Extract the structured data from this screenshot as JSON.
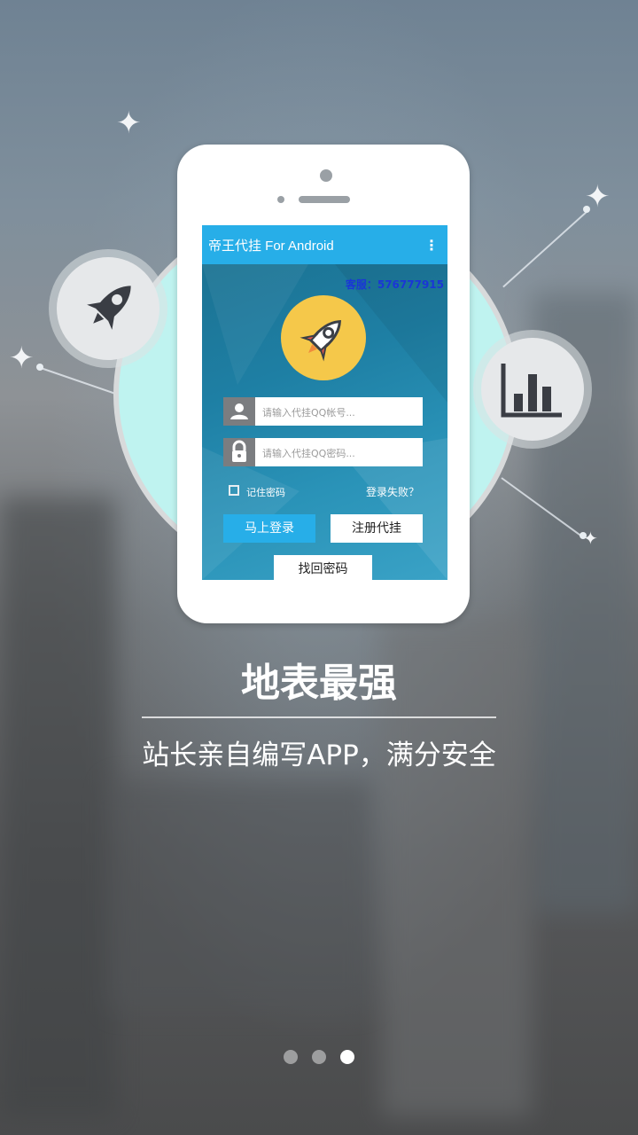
{
  "app": {
    "title": "帝王代挂 For Android",
    "menu_icon": "more-vert-icon",
    "customer_service": "客服：576777915",
    "account_placeholder": "请输入代挂QQ帐号...",
    "password_placeholder": "请输入代挂QQ密码...",
    "remember_password": "记住密码",
    "login_failed": "登录失败？",
    "login_button": "马上登录",
    "register_button": "注册代挂",
    "recover_button": "找回密码"
  },
  "slide": {
    "headline": "地表最强",
    "subtitle": "站长亲自编写APP，满分安全"
  },
  "pager": {
    "count": 3,
    "active_index": 2
  },
  "colors": {
    "accent": "#27aee8",
    "logo_bg": "#f5c84a",
    "customer_service_text": "#1a36d6"
  },
  "icons": [
    "rocket-icon",
    "bar-chart-icon",
    "user-icon",
    "lock-icon",
    "sparkle-icon"
  ]
}
